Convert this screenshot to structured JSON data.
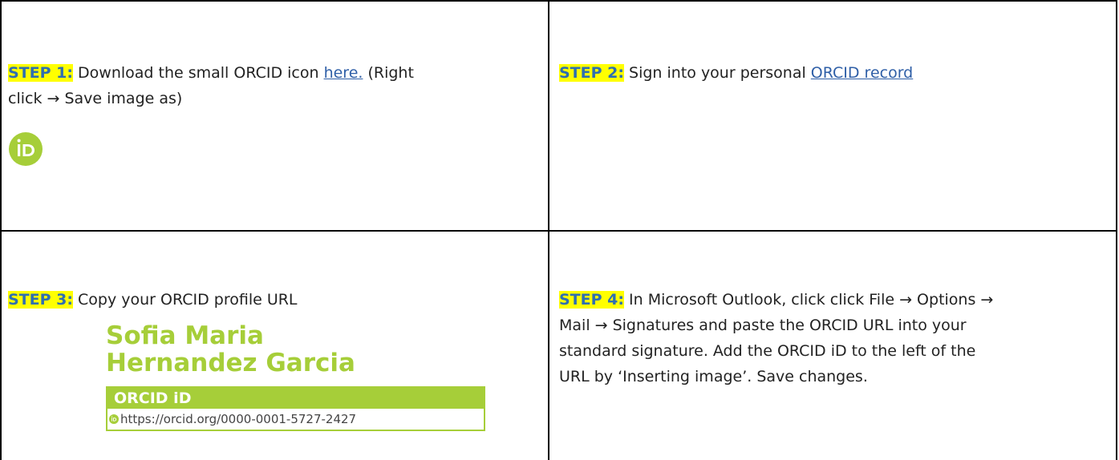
{
  "step1": {
    "label": "STEP 1:",
    "text_a": " Download the small ORCID icon ",
    "link": "here.",
    "text_b": " (Right",
    "text_c": "click ",
    "arrow": "→",
    "text_d": " Save image as)",
    "logo_icon": "orcid-id-icon"
  },
  "step2": {
    "label": "STEP 2:",
    "text_a": " Sign into your personal ",
    "link": "ORCID record"
  },
  "step3": {
    "label": "STEP 3:",
    "text_a": " Copy your ORCID profile URL",
    "profile": {
      "name_line1": "Sofia Maria",
      "name_line2": "Hernandez Garcia",
      "box_title": "ORCID iD",
      "url": "https://orcid.org/0000-0001-5727-2427"
    }
  },
  "step4": {
    "label": "STEP 4:",
    "line1": " In Microsoft Outlook, click click File → Options →",
    "line2": "Mail → Signatures and paste the ORCID URL into your",
    "line3": "standard signature. Add the ORCID iD to the left of the",
    "line4": "URL by ‘Inserting image’. Save changes."
  },
  "colors": {
    "orcid_green": "#a6ce39",
    "highlight": "#ffff00",
    "link": "#2f5fa7"
  }
}
